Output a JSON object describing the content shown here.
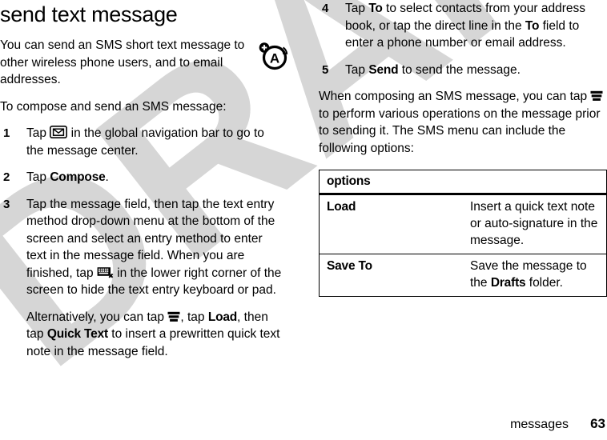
{
  "page": {
    "title": "send text message",
    "footer_section": "messages",
    "footer_page_number": "63",
    "watermark_text": "DRAFT"
  },
  "left_column": {
    "intro_paragraph": "You can send an SMS short text message to other wireless phone users, and to email addresses.",
    "lead_in": "To compose and send an SMS message:",
    "steps": [
      {
        "num": "1",
        "text_before_icon": "Tap ",
        "icon": "envelope-icon",
        "text_after_icon": " in the global navigation bar to go to the message center."
      },
      {
        "num": "2",
        "text_before_bold": "Tap ",
        "bold": "Compose",
        "text_after_bold": "."
      },
      {
        "num": "3",
        "text_before_icon": "Tap the message field, then tap the text entry method drop-down menu at the bottom of the screen and select an entry method to enter text in the message field. When you are finished, tap ",
        "icon": "hide-keyboard-icon",
        "text_after_icon": " in the lower right corner of the screen to hide the text entry keyboard or pad.",
        "sub_parts": {
          "p1": "Alternatively, you can tap ",
          "icon": "menu-icon",
          "p2": ", tap ",
          "bold1": "Load",
          "p3": ", then tap ",
          "bold2": "Quick Text",
          "p4": " to insert a prewritten quick text note in the message field."
        }
      }
    ],
    "side_glyph": "audio-a-plus-icon"
  },
  "right_column": {
    "steps": [
      {
        "num": "4",
        "p1": "Tap ",
        "bold1": "To",
        "p2": " to select contacts from your address book, or tap the direct line in the ",
        "bold2": "To",
        "p3": " field to enter a phone number or email address."
      },
      {
        "num": "5",
        "p1": "Tap ",
        "bold1": "Send",
        "p2": " to send the message."
      }
    ],
    "closing_paragraph": {
      "p1": "When composing an SMS message, you can tap ",
      "icon": "menu-icon",
      "p2": " to perform various operations on the message prior to sending it. The SMS menu can include the following options:"
    },
    "options_table": {
      "header": "options",
      "rows": [
        {
          "key": "Load",
          "value_p1": "Insert a quick text note or auto-signature in the message.",
          "value_bold": "",
          "value_p2": ""
        },
        {
          "key": "Save To",
          "value_p1": "Save the message to the ",
          "value_bold": "Drafts",
          "value_p2": " folder."
        }
      ]
    }
  },
  "colors": {
    "text": "#000000",
    "background": "#ffffff",
    "watermark": "#d6d6d6",
    "table_border": "#000000"
  }
}
